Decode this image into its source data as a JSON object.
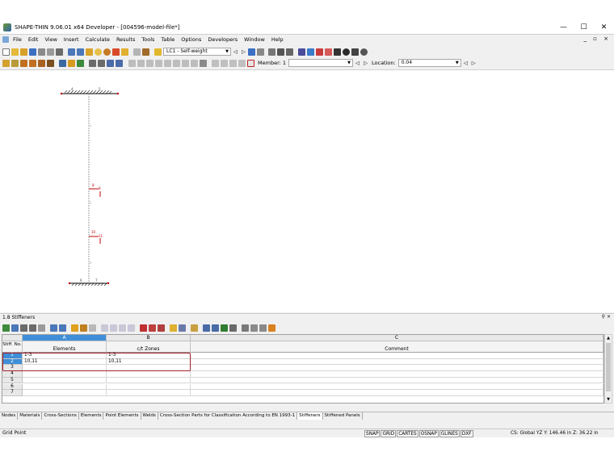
{
  "window": {
    "title": "SHAPE-THIN 9.06.01 x64 Developer - [004596-model-file*]"
  },
  "menu": [
    "File",
    "Edit",
    "View",
    "Insert",
    "Calculate",
    "Results",
    "Tools",
    "Table",
    "Options",
    "Developers",
    "Window",
    "Help"
  ],
  "toolbar": {
    "load_case": "LC1 - Self-weight",
    "member_label": "Member: 1",
    "location_label": "Location:",
    "location_value": "0.04"
  },
  "model": {
    "node_labels": [
      "4",
      "5",
      "8",
      "9",
      "10",
      "11",
      "6",
      "7"
    ],
    "element_labels": [
      "1",
      "2",
      "3"
    ]
  },
  "panel": {
    "title": "1.8 Stiffeners",
    "columns": [
      {
        "letter": "A",
        "header": "Elements"
      },
      {
        "letter": "B",
        "header": "c/t Zones"
      },
      {
        "letter": "C",
        "header": "Comment"
      }
    ],
    "row_header_title": "Stiff. No.",
    "rows": [
      {
        "no": "1",
        "elements": "1-3",
        "zones": "1-3",
        "comment": ""
      },
      {
        "no": "2",
        "elements": "10,11",
        "zones": "10,11",
        "comment": ""
      },
      {
        "no": "3",
        "elements": "",
        "zones": "",
        "comment": ""
      },
      {
        "no": "4",
        "elements": "",
        "zones": "",
        "comment": ""
      },
      {
        "no": "5",
        "elements": "",
        "zones": "",
        "comment": ""
      },
      {
        "no": "6",
        "elements": "",
        "zones": "",
        "comment": ""
      },
      {
        "no": "7",
        "elements": "",
        "zones": "",
        "comment": ""
      }
    ]
  },
  "tabs": [
    "Nodes",
    "Materials",
    "Cross-Sections",
    "Elements",
    "Point Elements",
    "Welds",
    "Cross-Section Parts for Classification According to EN 1993-1",
    "Stiffeners",
    "Stiffened Panels"
  ],
  "active_tab": "Stiffeners",
  "status": {
    "left": "Grid Point",
    "toggles": [
      "SNAP",
      "GRID",
      "CARTES",
      "OSNAP",
      "GLINES",
      "DXF"
    ],
    "coords": "CS: Global YZ  Y:  146.46 in    Z:  36.22 in"
  },
  "colors": {
    "accent": "#3f8fd8",
    "highlight": "#a3202c",
    "model": "#c00000"
  }
}
